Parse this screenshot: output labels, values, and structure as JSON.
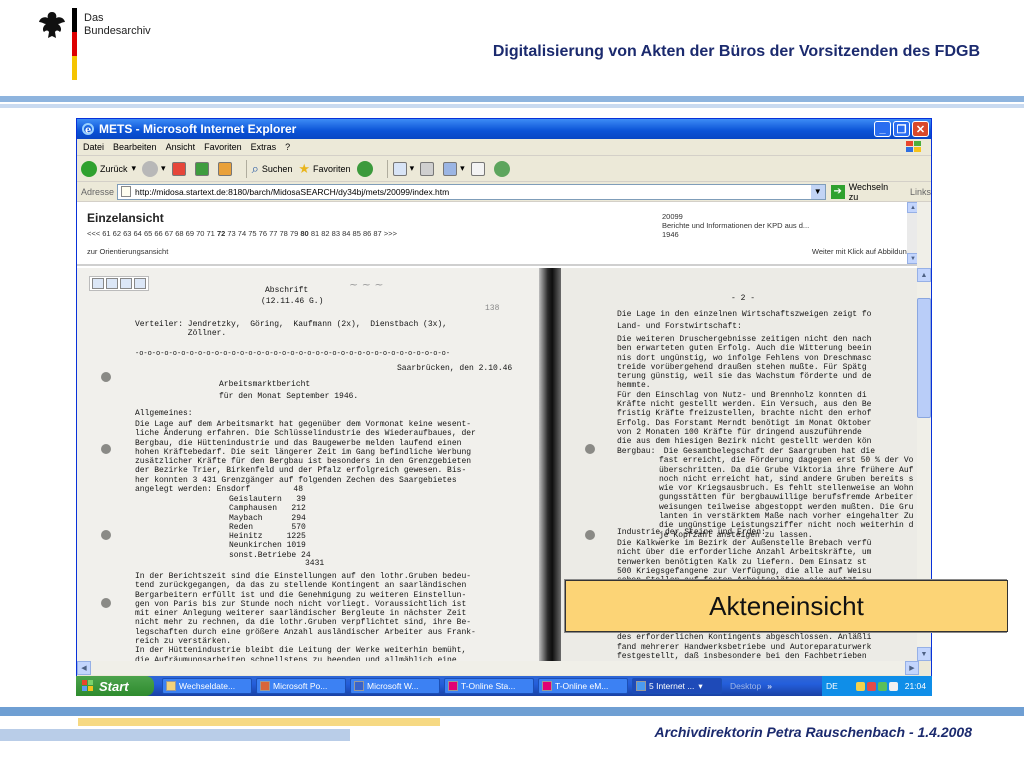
{
  "slide": {
    "logo_line1": "Das",
    "logo_line2": "Bundesarchiv",
    "title": "Digitalisierung von Akten der Büros der Vorsitzenden des FDGB",
    "footer": "Archivdirektorin Petra Rauschenbach - 1.4.2008",
    "overlay_label": "Akteneinsicht",
    "colors": {
      "title": "#1b2a6e",
      "band": "#8eb4de",
      "overlay": "#fcd476",
      "footer_yellow": "#f6d983"
    }
  },
  "browser": {
    "title": "METS - Microsoft Internet Explorer",
    "menu": [
      "Datei",
      "Bearbeiten",
      "Ansicht",
      "Favoriten",
      "Extras",
      "?"
    ],
    "toolbar": {
      "back": "Zurück",
      "search": "Suchen",
      "favorites": "Favoriten"
    },
    "address_label": "Adresse",
    "url": "http://midosa.startext.de:8180/barch/MidosaSEARCH/dy34bj/mets/20099/index.htm",
    "go_label": "Wechseln zu",
    "links_label": "Links"
  },
  "mets": {
    "heading": "Einzelansicht",
    "nav_prev": "<<<",
    "pages_before": "61 62 63 64 65 66 67 68 69 70 71",
    "page_bold_1": "72",
    "pages_mid": "73 74 75 76 77 78 79",
    "page_bold_2": "80",
    "pages_after": "81 82 83 84 85 86 87",
    "nav_next": ">>>",
    "orientation_link": "zur Orientierungsansicht",
    "doc_number": "20099",
    "doc_title": "Berichte und Informationen der KPD aus d...",
    "doc_year": "1946",
    "next_hint": "Weiter mit Klick auf Abbildung"
  },
  "scan_left": {
    "header_1": "Abschrift",
    "header_2": "(12.11.46 G.)",
    "distribution": "Verteiler: Jendretzky,  Göring,  Kaufmann (2x),  Dienstbach (3x),\n           Zöllner.",
    "dash_line": "-o-o-o-o-o-o-o-o-o-o-o-o-o-o-o-o-o-o-o-o-o-o-o-o-o-o-o-o-o-o-o-o-o-o-o-o-o-",
    "place_date": "Saarbrücken, den 2.10.46",
    "report_title_1": "Arbeitsmarktbericht",
    "report_title_2": "für den Monat September 1946.",
    "section_general": "Allgemeines:",
    "body_1": "Die Lage auf dem Arbeitsmarkt hat gegenüber dem Vormonat keine wesent-\nliche Änderung erfahren. Die Schlüsselindustrie des Wiederaufbaues, der\nBergbau, die Hüttenindustrie und das Baugewerbe melden laufend einen\nhohen Kräftebedarf. Die seit längerer Zeit im Gang befindliche Werbung\nzusätzlicher Kräfte für den Bergbau ist besonders in den Grenzgebieten\nder Bezirke Trier, Birkenfeld und der Pfalz erfolgreich gewesen. Bis-\nher konnten 3 431 Grenzgänger auf folgenden Zechen des Saargebietes\nangelegt werden: Ensdorf         48",
    "mines": "Geislautern   39\nCamphausen   212\nMaybach      294\nReden        570\nHeinitz     1225\nNeunkirchen 1019\nsonst.Betriebe 24",
    "mines_total": "3431",
    "body_2": "In der Berichtszeit sind die Einstellungen auf den lothr.Gruben bedeu-\ntend zurückgegangen, da das zu stellende Kontingent an saarländischen\nBergarbeitern erfüllt ist und die Genehmigung zu weiteren Einstellun-\ngen von Paris bis zur Stunde noch nicht vorliegt. Voraussichtlich ist\nmit einer Anlegung weiterer saarländischer Bergleute in nächster Zeit\nnicht mehr zu rechnen, da die lothr.Gruben verpflichtet sind, ihre Be-\nlegschaften durch eine größere Anzahl ausländischer Arbeiter aus Frank-\nreich zu verstärken.\nIn der Hüttenindustrie bleibt die Leitung der Werke weiterhin bemüht,\ndie Aufräumungsarbeiten schnellstens zu beenden und allmählich eine\nnormale Fabrikation im Rahmen der Regierungsbestimmungen in Gang zu",
    "page_mark": "138"
  },
  "scan_right": {
    "page_number": "- 2 -",
    "intro": "Die Lage in den einzelnen Wirtschaftszweigen zeigt fo",
    "section_agri": "Land- und Forstwirtschaft:",
    "body_1": "Die weiteren Druschergebnisse zeitigen nicht den nach\nben erwarteten guten Erfolg. Auch die Witterung beein\nnis dort ungünstig, wo infolge Fehlens von Dreschmasc\ntreide vorübergehend draußen stehen mußte. Für Spätg\nterung günstig, weil sie das Wachstum förderte und de\nhemmte.\nFür den Einschlag von Nutz- und Brennholz konnten di\nKräfte nicht gestellt werden. Ein Versuch, aus den Be\nfristig Kräfte freizustellen, brachte nicht den erhof\nErfolg. Das Forstamt Merndt benötigt im Monat Oktober\nvon 2 Monaten 100 Kräfte für dringend auszuführende\ndie aus dem hiesigen Bezirk nicht gestellt werden kön",
    "section_mining": "Bergbau:",
    "body_2": " Die Gesamtbelegschaft der Saargruben hat die\nfast erreicht, die Förderung dagegen erst 50 % der Vo\nüberschritten. Da die Grube Viktoria ihre frühere Auf\nnoch nicht erreicht hat, sind andere Gruben bereits s\nwie vor Kriegsausbruch. Es fehlt stellenweise an Wohn\ngungsstätten für bergbauwillige berufsfremde Arbeiter\nweisungen teilweise abgestoppt werden mußten. Die Gru\nlanten in verstärktem Maße nach vorher eingehalter Zu\ndie ungünstige Leistungsziffer nicht noch weiterhin d\nje Kopfzahl ansteigen zu lassen.",
    "section_stone": "Industrie der Steine und Erden:",
    "body_3": "Die Kalkwerke im Bezirk der Außenstelle Brebach verfü\nnicht über die erforderliche Anzahl Arbeitskräfte, um\ntenwerken benötigten Kalk zu liefern. Dem Einsatz st\n500 Kriegsgefangene zur Verfügung, die alle auf Weisu\nschen Stellen auf festen Arbeitsplätzen eingesetzt s",
    "body_4": "Arbeitskräften zur Burbacher Hütte ist vorläufig durc\ndes erforderlichen Kontingents abgeschlossen. Anläßli\nfand mehrerer Handwerksbetriebe und Autoreparaturwerk\nfestgestellt, daß insbesondere bei den Fachbetrieben"
  },
  "taskbar": {
    "start": "Start",
    "tasks": [
      "Wechseldate...",
      "Microsoft Po...",
      "Microsoft W...",
      "T-Online Sta...",
      "T-Online eM...",
      "5 Internet ..."
    ],
    "desktop": "Desktop",
    "lang": "DE",
    "clock": "21:04"
  }
}
